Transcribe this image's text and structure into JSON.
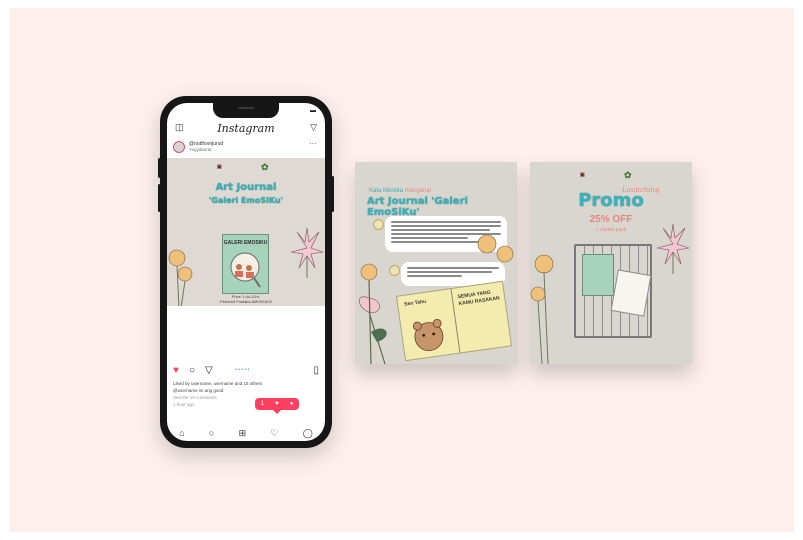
{
  "phone": {
    "app_title": "Instagram",
    "username": "@nuttfoonjunaf",
    "location": "Yogyakarta",
    "post": {
      "title_line1": "Art Journal",
      "title_line2": "'Galeri EmoSiKu'",
      "book_title": "GALERI EMOSIKU",
      "note1": "Price 1 dd-10/n.",
      "note2": "Penerbit Pustaka AMOKUKO",
      "note3": "Diamon pembelian via halaman yang tertera"
    },
    "likes": "Liked by username, username and 15 others",
    "caption": "@username ini ang good",
    "comments": "See the 15 comments",
    "time": "1 hour ago",
    "notification": {
      "comments": "1",
      "likes": "1",
      "follows": "1"
    }
  },
  "card1": {
    "subtitle_pre": "Kata Mereka",
    "subtitle_hl": "mengenai",
    "title": "Art Journal 'Galeri EmoSiKu'",
    "journal_left": "Sen Tahu",
    "journal_right": "SEMUA YANG KAMU RASAKAN"
  },
  "card2": {
    "launching": "Launching",
    "promo": "Promo",
    "discount": "25% OFF",
    "sticker": "+ sticker pack"
  },
  "colors": {
    "canvas": "#fcefec",
    "teal": "#3ab3bb",
    "coral": "#e8857a",
    "notif": "#ff3f5f"
  }
}
